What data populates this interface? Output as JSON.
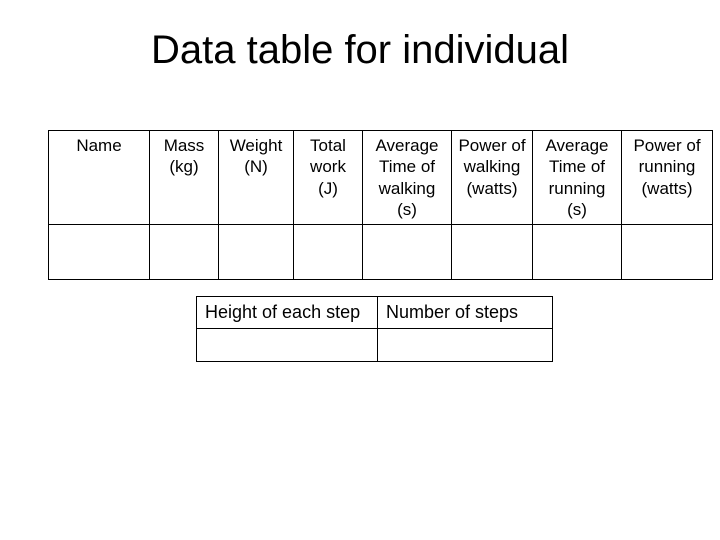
{
  "title": "Data table for individual",
  "mainTable": {
    "headers": [
      "Name",
      "Mass (kg)",
      "Weight (N)",
      "Total work (J)",
      "Average Time of walking (s)",
      "Power of walking (watts)",
      "Average Time of running (s)",
      "Power of running (watts)"
    ],
    "rows": [
      [
        "",
        "",
        "",
        "",
        "",
        "",
        "",
        ""
      ]
    ]
  },
  "subTable": {
    "headers": [
      "Height of each step",
      "Number of steps"
    ],
    "rows": [
      [
        "",
        ""
      ]
    ]
  }
}
